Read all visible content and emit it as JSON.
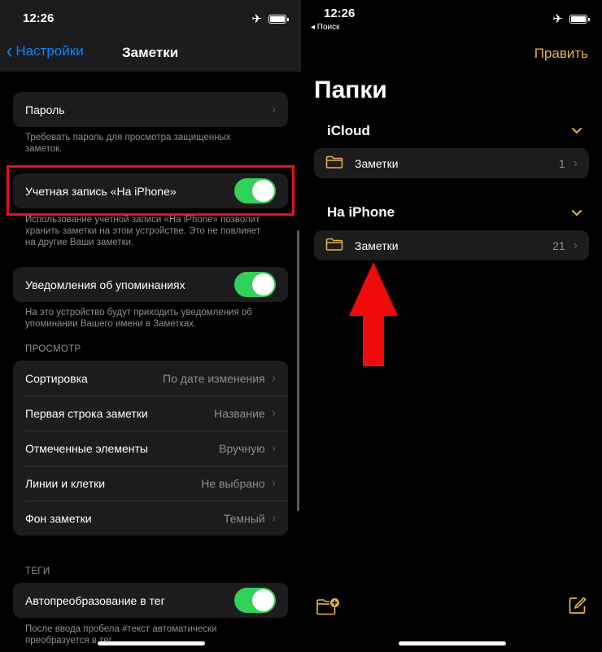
{
  "left": {
    "status": {
      "time": "12:26"
    },
    "nav": {
      "back_label": "Настройки",
      "title": "Заметки"
    },
    "password": {
      "label": "Пароль",
      "footnote": "Требовать пароль для просмотра защищенных заметок."
    },
    "on_iphone_account": {
      "label": "Учетная запись «На iPhone»",
      "toggle_on": true,
      "footnote": "Использование учетной записи «На iPhone» позволит хранить заметки на этом устройстве. Это не повлияет на другие Ваши заметки."
    },
    "mentions": {
      "label": "Уведомления об упоминаниях",
      "toggle_on": true,
      "footnote": "На это устройство будут приходить уведомления об упоминании Вашего имени в Заметках."
    },
    "viewing": {
      "header": "ПРОСМОТР",
      "rows": [
        {
          "label": "Сортировка",
          "value": "По дате изменения"
        },
        {
          "label": "Первая строка заметки",
          "value": "Название"
        },
        {
          "label": "Отмеченные элементы",
          "value": "Вручную"
        },
        {
          "label": "Линии и клетки",
          "value": "Не выбрано"
        },
        {
          "label": "Фон заметки",
          "value": "Темный"
        }
      ]
    },
    "tags": {
      "header": "ТЕГИ",
      "label": "Автопреобразование в тег",
      "toggle_on": true,
      "footnote": "После ввода пробела #текст автоматически преобразуется в тег."
    }
  },
  "right": {
    "status": {
      "time": "12:26",
      "back_app": "◂ Поиск"
    },
    "edit_label": "Править",
    "title": "Папки",
    "sections": [
      {
        "title": "iCloud",
        "folder": {
          "name": "Заметки",
          "count": "1"
        }
      },
      {
        "title": "На iPhone",
        "folder": {
          "name": "Заметки",
          "count": "21"
        }
      }
    ]
  },
  "colors": {
    "accent_blue": "#0a84ff",
    "accent_yellow": "#e6b244",
    "toggle_green": "#30d158",
    "highlight_red": "#e8101c"
  },
  "icons": [
    "airplane-icon",
    "battery-icon",
    "chevron-left-icon",
    "chevron-right-icon",
    "chevron-down-icon",
    "folder-icon",
    "new-folder-icon",
    "compose-icon",
    "red-arrow-annotation"
  ]
}
